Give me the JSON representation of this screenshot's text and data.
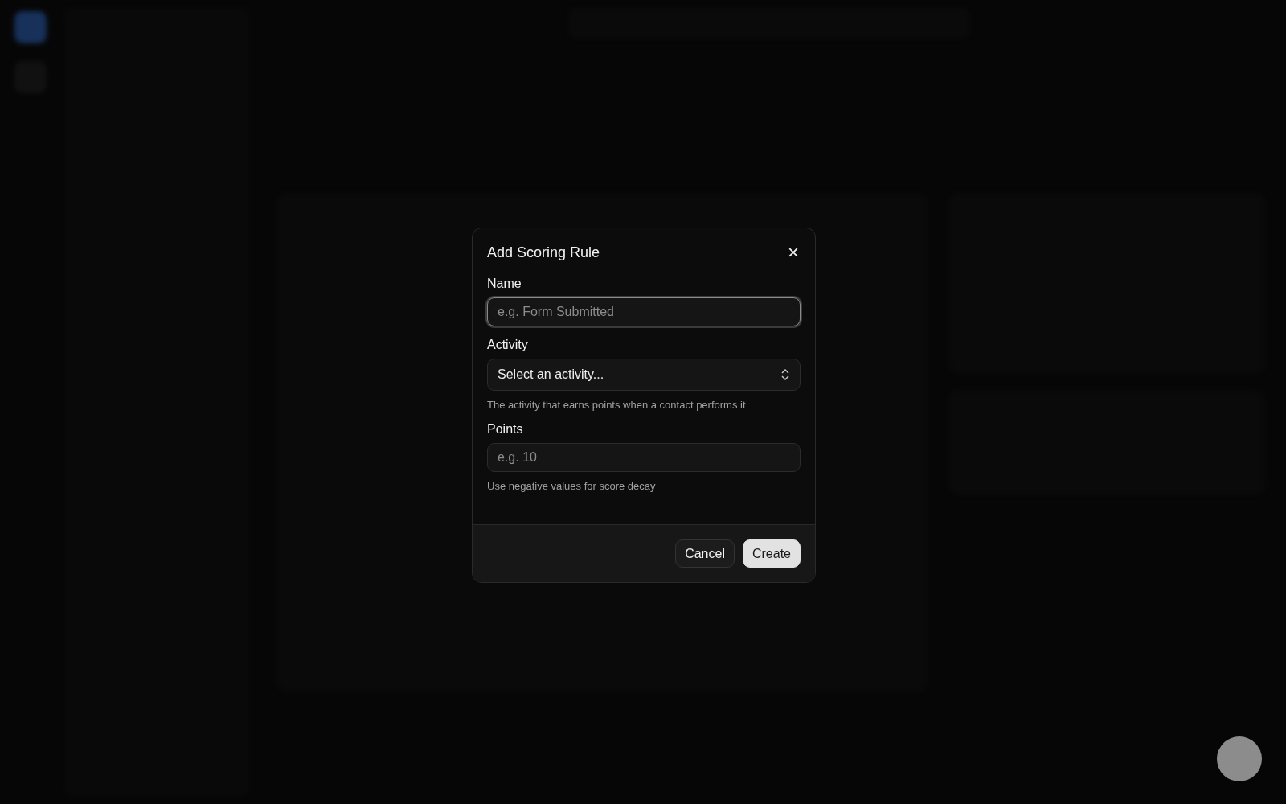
{
  "dialog": {
    "title": "Add Scoring Rule",
    "close": "×",
    "fields": [
      {
        "kind": "text",
        "label": "Name",
        "placeholder": "e.g. Form Submitted",
        "focused": true
      },
      {
        "kind": "select",
        "label": "Activity",
        "value": "Select an activity...",
        "hint": "The activity that earns points when a contact performs it",
        "focused": false
      },
      {
        "kind": "text",
        "label": "Points",
        "placeholder": "e.g. 10",
        "hint": "Use negative values for score decay",
        "focused": false
      }
    ],
    "buttons": [
      {
        "label": "Cancel",
        "primary": false
      },
      {
        "label": "Create",
        "primary": true
      }
    ]
  }
}
